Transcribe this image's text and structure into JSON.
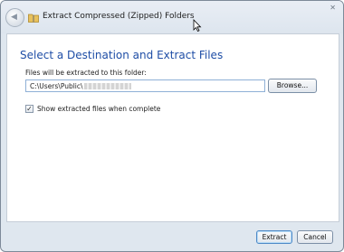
{
  "window": {
    "title": "Extract Compressed (Zipped) Folders",
    "close_glyph": "✕"
  },
  "icons": {
    "back": "back-arrow-icon",
    "folder": "zip-folder-icon",
    "close": "close-icon",
    "cursor": "mouse-pointer-icon",
    "check": "checkmark-icon"
  },
  "main": {
    "heading": "Select a Destination and Extract Files",
    "folder_label": "Files will be extracted to this folder:",
    "path_value": "C:\\Users\\Public\\",
    "browse_label": "Browse...",
    "show_files_label": "Show extracted files when complete",
    "show_files_checked": true
  },
  "footer": {
    "extract_label": "Extract",
    "cancel_label": "Cancel"
  },
  "colors": {
    "heading": "#1f4ea6",
    "frame": "#dfe7ef",
    "default_button_border": "#4e89c7"
  }
}
